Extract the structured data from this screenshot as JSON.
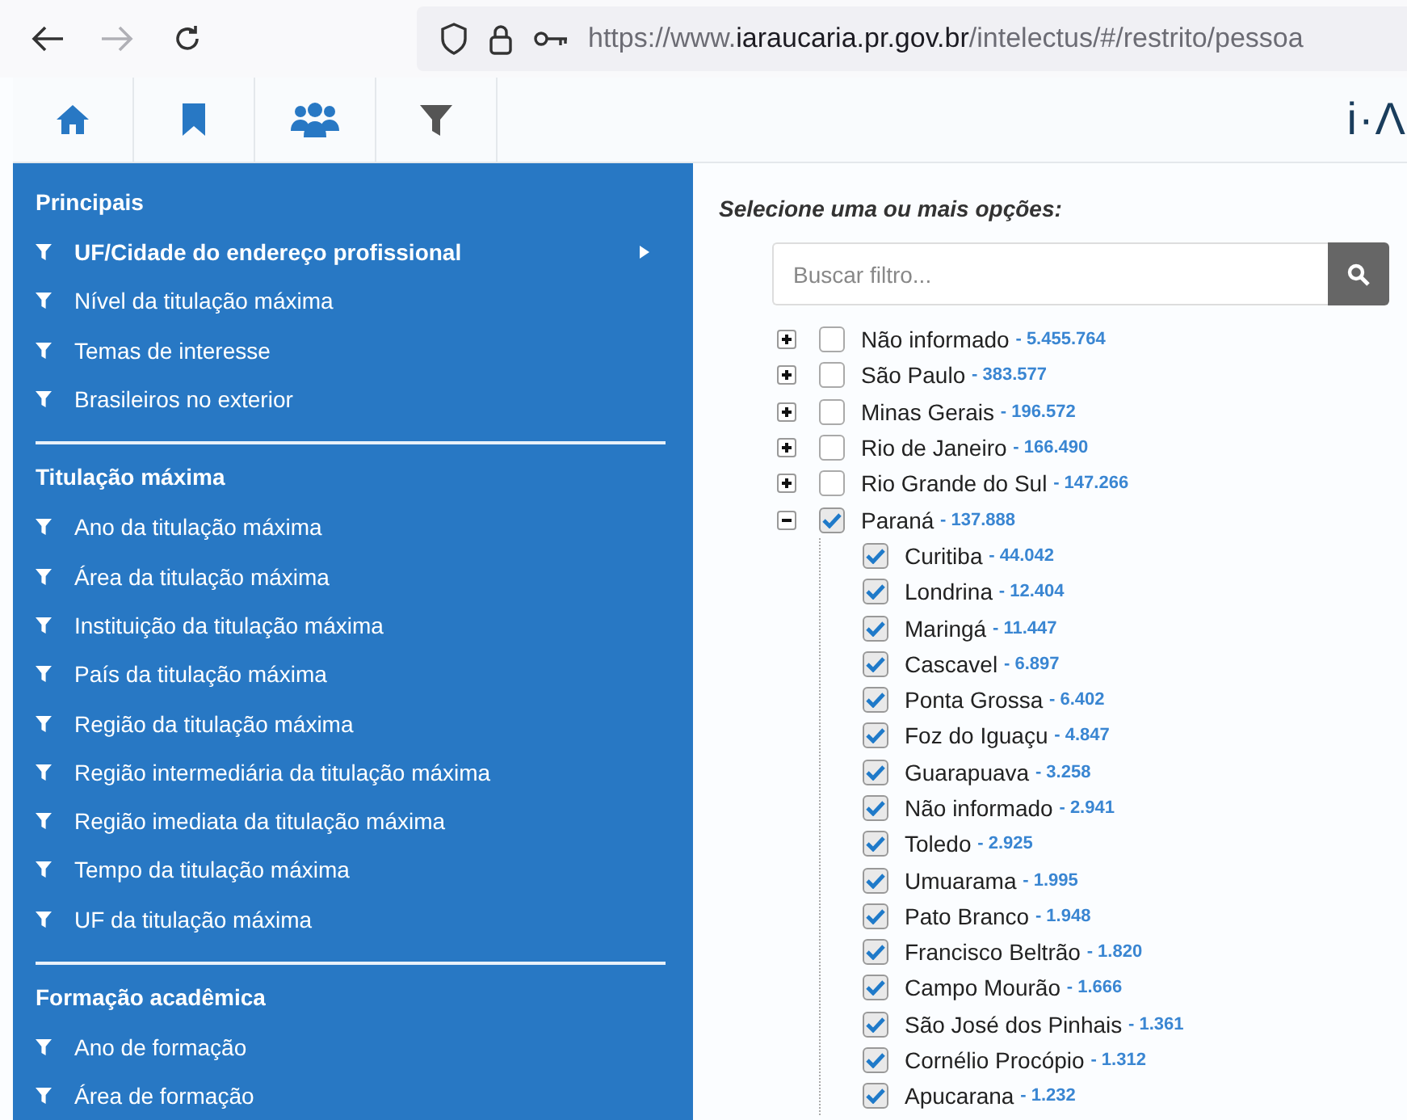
{
  "browser": {
    "url_prefix": "https://www.",
    "url_domain": "iaraucaria.pr.gov.br",
    "url_path": "/intelectus/#/restrito/pessoa"
  },
  "toolbar": {
    "tabs": [
      {
        "kind": "home"
      },
      {
        "kind": "bookmark"
      },
      {
        "kind": "users"
      },
      {
        "kind": "filter"
      }
    ],
    "logo": "i·Λ"
  },
  "sidebar": {
    "sections": [
      {
        "title": "Principais",
        "items": [
          {
            "label": "UF/Cidade do endereço profissional",
            "selected": true
          },
          {
            "label": "Nível da titulação máxima",
            "selected": false
          },
          {
            "label": "Temas de interesse",
            "selected": false
          },
          {
            "label": "Brasileiros no exterior",
            "selected": false
          }
        ]
      },
      {
        "title": "Titulação máxima",
        "items": [
          {
            "label": "Ano da titulação máxima",
            "selected": false
          },
          {
            "label": "Área da titulação máxima",
            "selected": false
          },
          {
            "label": "Instituição da titulação máxima",
            "selected": false
          },
          {
            "label": "País da titulação máxima",
            "selected": false
          },
          {
            "label": "Região da titulação máxima",
            "selected": false
          },
          {
            "label": "Região intermediária da titulação máxima",
            "selected": false
          },
          {
            "label": "Região imediata da titulação máxima",
            "selected": false
          },
          {
            "label": "Tempo da titulação máxima",
            "selected": false
          },
          {
            "label": "UF da titulação máxima",
            "selected": false
          }
        ]
      },
      {
        "title": "Formação acadêmica",
        "items": [
          {
            "label": "Ano de formação",
            "selected": false
          },
          {
            "label": "Área de formação",
            "selected": false
          }
        ]
      }
    ]
  },
  "panel": {
    "heading": "Selecione uma ou mais opções:",
    "search": {
      "placeholder": "Buscar filtro..."
    },
    "tree": [
      {
        "label": "Não informado",
        "count": "- 5.455.764",
        "checked": false,
        "expanded": false
      },
      {
        "label": "São Paulo",
        "count": "- 383.577",
        "checked": false,
        "expanded": false
      },
      {
        "label": "Minas Gerais",
        "count": "- 196.572",
        "checked": false,
        "expanded": false
      },
      {
        "label": "Rio de Janeiro",
        "count": "- 166.490",
        "checked": false,
        "expanded": false
      },
      {
        "label": "Rio Grande do Sul",
        "count": "- 147.266",
        "checked": false,
        "expanded": false
      },
      {
        "label": "Paraná",
        "count": "- 137.888",
        "checked": true,
        "expanded": true,
        "children": [
          {
            "label": "Curitiba",
            "count": "- 44.042",
            "checked": true
          },
          {
            "label": "Londrina",
            "count": "- 12.404",
            "checked": true
          },
          {
            "label": "Maringá",
            "count": "- 11.447",
            "checked": true
          },
          {
            "label": "Cascavel",
            "count": "- 6.897",
            "checked": true
          },
          {
            "label": "Ponta Grossa",
            "count": "- 6.402",
            "checked": true
          },
          {
            "label": "Foz do Iguaçu",
            "count": "- 4.847",
            "checked": true
          },
          {
            "label": "Guarapuava",
            "count": "- 3.258",
            "checked": true
          },
          {
            "label": "Não informado",
            "count": "- 2.941",
            "checked": true
          },
          {
            "label": "Toledo",
            "count": "- 2.925",
            "checked": true
          },
          {
            "label": "Umuarama",
            "count": "- 1.995",
            "checked": true
          },
          {
            "label": "Pato Branco",
            "count": "- 1.948",
            "checked": true
          },
          {
            "label": "Francisco Beltrão",
            "count": "- 1.820",
            "checked": true
          },
          {
            "label": "Campo Mourão",
            "count": "- 1.666",
            "checked": true
          },
          {
            "label": "São José dos Pinhais",
            "count": "- 1.361",
            "checked": true
          },
          {
            "label": "Cornélio Procópio",
            "count": "- 1.312",
            "checked": true
          },
          {
            "label": "Apucarana",
            "count": "- 1.232",
            "checked": true
          }
        ]
      }
    ]
  }
}
